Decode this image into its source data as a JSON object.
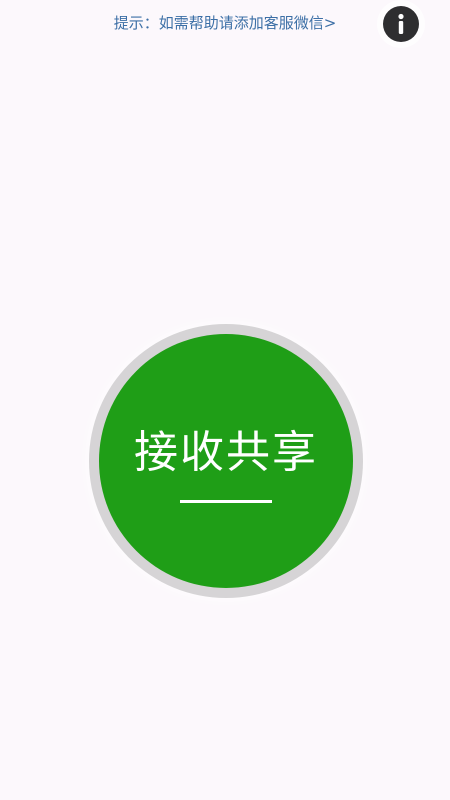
{
  "header": {
    "hint_text": "提示：如需帮助请添加客服微信>",
    "info_icon": "info-icon"
  },
  "main": {
    "share_button_label": "接收共享"
  },
  "colors": {
    "background": "#fcf8fc",
    "hint_link": "#3c6fa6",
    "info_button": "#2e2e30",
    "share_green": "#1f9e17",
    "share_ring": "#d6d4d6"
  }
}
